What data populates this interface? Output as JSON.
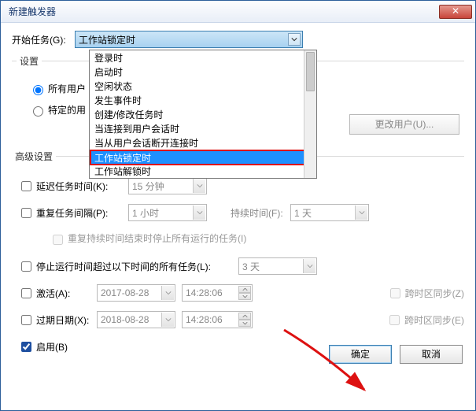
{
  "title": "新建触发器",
  "close_x": "X",
  "start_task": {
    "label": "开始任务(G):",
    "value": "工作站锁定时"
  },
  "dropdown_options": [
    "登录时",
    "启动时",
    "空闲状态",
    "发生事件时",
    "创建/修改任务时",
    "当连接到用户会话时",
    "当从用户会话断开连接时",
    "工作站锁定时",
    "工作站解锁时"
  ],
  "dropdown_selected_index": 7,
  "settings": {
    "legend": "设置",
    "all_users": "所有用户",
    "specific_user": "特定的用",
    "change_user_btn": "更改用户(U)..."
  },
  "advanced": {
    "legend": "高级设置",
    "delay": {
      "label": "延迟任务时间(K):",
      "value": "15 分钟"
    },
    "repeat": {
      "label": "重复任务间隔(P):",
      "value": "1 小时"
    },
    "duration": {
      "label": "持续时间(F):",
      "value": "1 天"
    },
    "stop_on_end": "重复持续时间结束时停止所有运行的任务(I)",
    "stop_longer": {
      "label": "停止运行时间超过以下时间的所有任务(L):",
      "value": "3 天"
    },
    "activate": {
      "label": "激活(A):",
      "date": "2017-08-28",
      "time": "14:28:06"
    },
    "expire": {
      "label": "过期日期(X):",
      "date": "2018-08-28",
      "time": "14:28:06"
    },
    "tz1": "跨时区同步(Z)",
    "tz2": "跨时区同步(E)",
    "enable": "启用(B)"
  },
  "buttons": {
    "ok": "确定",
    "cancel": "取消"
  }
}
